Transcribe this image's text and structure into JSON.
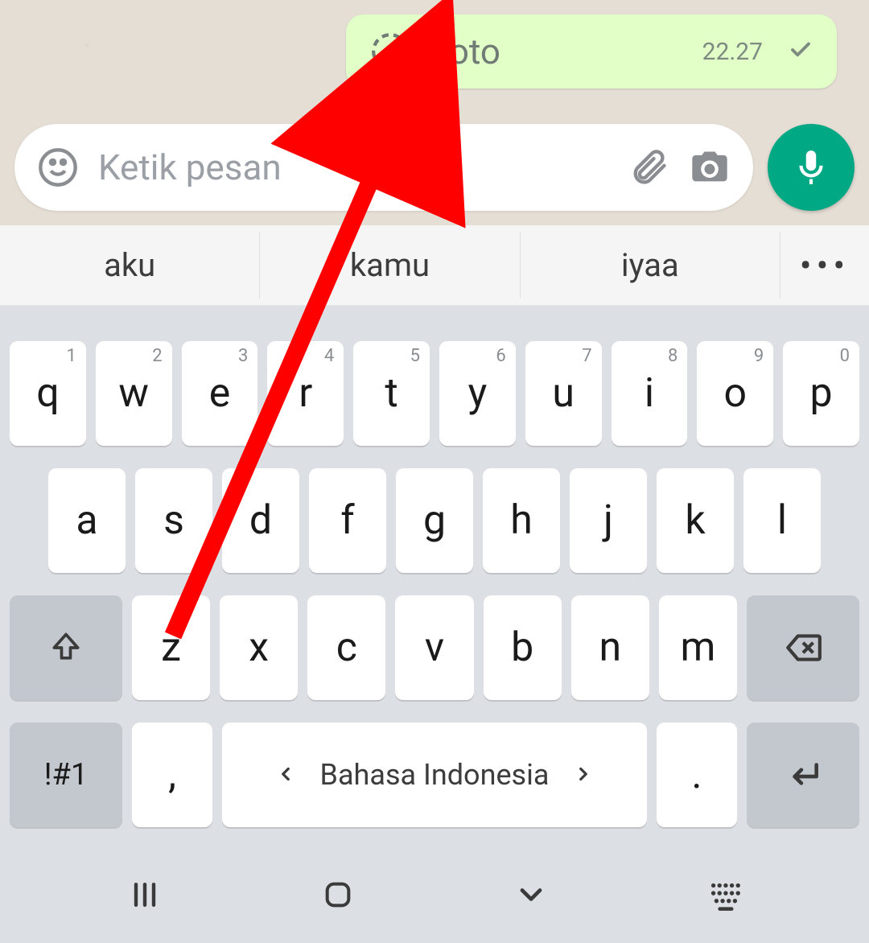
{
  "bubble": {
    "label": "Foto",
    "time": "22.27"
  },
  "input": {
    "placeholder": "Ketik pesan"
  },
  "suggestions": [
    "aku",
    "kamu",
    "iyaa"
  ],
  "keyboard": {
    "row1": [
      "q",
      "w",
      "e",
      "r",
      "t",
      "y",
      "u",
      "i",
      "o",
      "p"
    ],
    "row1hints": [
      "1",
      "2",
      "3",
      "4",
      "5",
      "6",
      "7",
      "8",
      "9",
      "0"
    ],
    "row2": [
      "a",
      "s",
      "d",
      "f",
      "g",
      "h",
      "j",
      "k",
      "l"
    ],
    "row3": [
      "z",
      "x",
      "c",
      "v",
      "b",
      "n",
      "m"
    ],
    "symKey": "!#1",
    "commaKey": ",",
    "spaceLabel": "Bahasa Indonesia",
    "periodKey": "."
  },
  "colors": {
    "accent": "#00a884",
    "bubble": "#e1ffc7",
    "annotation": "#ff0000"
  }
}
